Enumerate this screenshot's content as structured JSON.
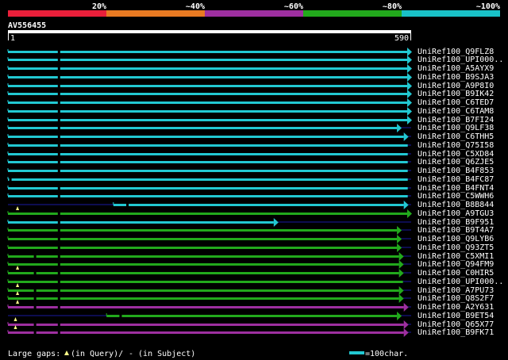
{
  "legend": {
    "bands": [
      {
        "label": "20%",
        "color": "#ea1f3a"
      },
      {
        "label": "~40%",
        "color": "#e97a22"
      },
      {
        "label": "~60%",
        "color": "#9e2fa0"
      },
      {
        "label": "~80%",
        "color": "#22a91c"
      },
      {
        "label": "~100%",
        "color": "#19c1c7"
      }
    ]
  },
  "query": {
    "name": "AV556455",
    "start": "1",
    "end": "590"
  },
  "colors": {
    "cyan": "#22c8d2",
    "green": "#22a91c",
    "purple": "#9e2fa0",
    "gap_line": "#1a1aa0"
  },
  "hits": [
    {
      "name": "UniRef100_Q9FLZ8",
      "color": "cyan",
      "start": 1,
      "end": 590,
      "arrow": true,
      "query_gaps": [],
      "subject_gaps": [
        75
      ]
    },
    {
      "name": "UniRef100_UPI000..",
      "color": "cyan",
      "start": 1,
      "end": 590,
      "arrow": true,
      "query_gaps": [],
      "subject_gaps": [
        75
      ]
    },
    {
      "name": "UniRef100_A5AYX9",
      "color": "cyan",
      "start": 1,
      "end": 590,
      "arrow": true,
      "query_gaps": [],
      "subject_gaps": [
        75
      ]
    },
    {
      "name": "UniRef100_B9SJA3",
      "color": "cyan",
      "start": 1,
      "end": 590,
      "arrow": true,
      "query_gaps": [],
      "subject_gaps": [
        75
      ]
    },
    {
      "name": "UniRef100_A9P8I0",
      "color": "cyan",
      "start": 1,
      "end": 590,
      "arrow": true,
      "query_gaps": [],
      "subject_gaps": [
        75
      ]
    },
    {
      "name": "UniRef100_B9IK42",
      "color": "cyan",
      "start": 1,
      "end": 590,
      "arrow": true,
      "query_gaps": [],
      "subject_gaps": [
        75
      ]
    },
    {
      "name": "UniRef100_C6TED7",
      "color": "cyan",
      "start": 1,
      "end": 590,
      "arrow": true,
      "query_gaps": [],
      "subject_gaps": [
        75
      ]
    },
    {
      "name": "UniRef100_C6TAM8",
      "color": "cyan",
      "start": 1,
      "end": 590,
      "arrow": true,
      "query_gaps": [],
      "subject_gaps": [
        75
      ]
    },
    {
      "name": "UniRef100_B7FI24",
      "color": "cyan",
      "start": 1,
      "end": 590,
      "arrow": true,
      "query_gaps": [],
      "subject_gaps": [
        75
      ]
    },
    {
      "name": "UniRef100_Q9LF38",
      "color": "cyan",
      "start": 1,
      "end": 575,
      "arrow": true,
      "query_gaps": [],
      "subject_gaps": [
        75
      ]
    },
    {
      "name": "UniRef100_C6THH5",
      "color": "cyan",
      "start": 1,
      "end": 585,
      "arrow": true,
      "query_gaps": [],
      "subject_gaps": [
        75
      ]
    },
    {
      "name": "UniRef100_Q75I58",
      "color": "cyan",
      "start": 1,
      "end": 585,
      "arrow": false,
      "query_gaps": [],
      "subject_gaps": [
        75
      ]
    },
    {
      "name": "UniRef100_C5XD84",
      "color": "cyan",
      "start": 1,
      "end": 585,
      "arrow": false,
      "query_gaps": [],
      "subject_gaps": [
        75
      ]
    },
    {
      "name": "UniRef100_Q6ZJE5",
      "color": "cyan",
      "start": 1,
      "end": 585,
      "arrow": false,
      "query_gaps": [],
      "subject_gaps": [
        75
      ]
    },
    {
      "name": "UniRef100_B4F853",
      "color": "cyan",
      "start": 1,
      "end": 585,
      "arrow": false,
      "query_gaps": [],
      "subject_gaps": [
        75
      ]
    },
    {
      "name": "UniRef100_B4FC87",
      "color": "cyan",
      "start": 1,
      "end": 585,
      "arrow": false,
      "query_gaps": [],
      "subject_gaps": [
        4
      ]
    },
    {
      "name": "UniRef100_B4FNT4",
      "color": "cyan",
      "start": 1,
      "end": 585,
      "arrow": false,
      "query_gaps": [],
      "subject_gaps": [
        75
      ]
    },
    {
      "name": "UniRef100_C5WWH6",
      "color": "cyan",
      "start": 1,
      "end": 585,
      "arrow": false,
      "query_gaps": [],
      "subject_gaps": [
        75
      ]
    },
    {
      "name": "UniRef100_B8B844",
      "color": "cyan",
      "start": 155,
      "end": 585,
      "arrow": true,
      "query_gaps": [],
      "subject_gaps": [
        175
      ]
    },
    {
      "name": "UniRef100_A9TGU3",
      "color": "green",
      "start": 1,
      "end": 590,
      "arrow": true,
      "query_gaps": [
        15
      ],
      "subject_gaps": [
        75
      ]
    },
    {
      "name": "UniRef100_B9F951",
      "color": "cyan",
      "start": 1,
      "end": 395,
      "arrow": true,
      "query_gaps": [],
      "subject_gaps": [
        75
      ]
    },
    {
      "name": "UniRef100_B9T4A7",
      "color": "green",
      "start": 1,
      "end": 575,
      "arrow": true,
      "query_gaps": [],
      "subject_gaps": [
        75
      ]
    },
    {
      "name": "UniRef100_Q9LYB6",
      "color": "green",
      "start": 1,
      "end": 575,
      "arrow": true,
      "query_gaps": [],
      "subject_gaps": [
        75
      ]
    },
    {
      "name": "UniRef100_Q93ZT5",
      "color": "green",
      "start": 1,
      "end": 575,
      "arrow": true,
      "query_gaps": [],
      "subject_gaps": [
        75
      ]
    },
    {
      "name": "UniRef100_C5XMI1",
      "color": "green",
      "start": 1,
      "end": 578,
      "arrow": true,
      "query_gaps": [],
      "subject_gaps": [
        40,
        75
      ]
    },
    {
      "name": "UniRef100_Q94FM9",
      "color": "green",
      "start": 1,
      "end": 578,
      "arrow": true,
      "query_gaps": [],
      "subject_gaps": [
        75
      ]
    },
    {
      "name": "UniRef100_C0HIR5",
      "color": "green",
      "start": 1,
      "end": 578,
      "arrow": true,
      "query_gaps": [
        15
      ],
      "subject_gaps": [
        40,
        75
      ]
    },
    {
      "name": "UniRef100_UPI000..",
      "color": "green",
      "start": 1,
      "end": 578,
      "arrow": false,
      "query_gaps": [],
      "subject_gaps": [
        75
      ]
    },
    {
      "name": "UniRef100_A7PU73",
      "color": "green",
      "start": 1,
      "end": 578,
      "arrow": true,
      "query_gaps": [
        15
      ],
      "subject_gaps": [
        40,
        75
      ]
    },
    {
      "name": "UniRef100_Q8S2F7",
      "color": "green",
      "start": 1,
      "end": 578,
      "arrow": true,
      "query_gaps": [
        15
      ],
      "subject_gaps": [
        40,
        75
      ]
    },
    {
      "name": "UniRef100_A2Y631",
      "color": "purple",
      "start": 1,
      "end": 585,
      "arrow": true,
      "query_gaps": [
        15
      ],
      "subject_gaps": [
        40,
        75
      ]
    },
    {
      "name": "UniRef100_B9ET54",
      "color": "green",
      "start": 145,
      "end": 575,
      "arrow": true,
      "query_gaps": [],
      "subject_gaps": [
        165
      ]
    },
    {
      "name": "UniRef100_Q65X77",
      "color": "purple",
      "start": 1,
      "end": 585,
      "arrow": true,
      "query_gaps": [
        12
      ],
      "subject_gaps": [
        40,
        75
      ]
    },
    {
      "name": "UniRef100_B9FK71",
      "color": "purple",
      "start": 1,
      "end": 585,
      "arrow": true,
      "query_gaps": [
        12
      ],
      "subject_gaps": [
        40,
        75
      ]
    }
  ],
  "footer": {
    "prefix": "Large gaps:",
    "query_text": "(in Query)/",
    "subject_text": "- (in Subject)",
    "scale_text": "=100char."
  }
}
